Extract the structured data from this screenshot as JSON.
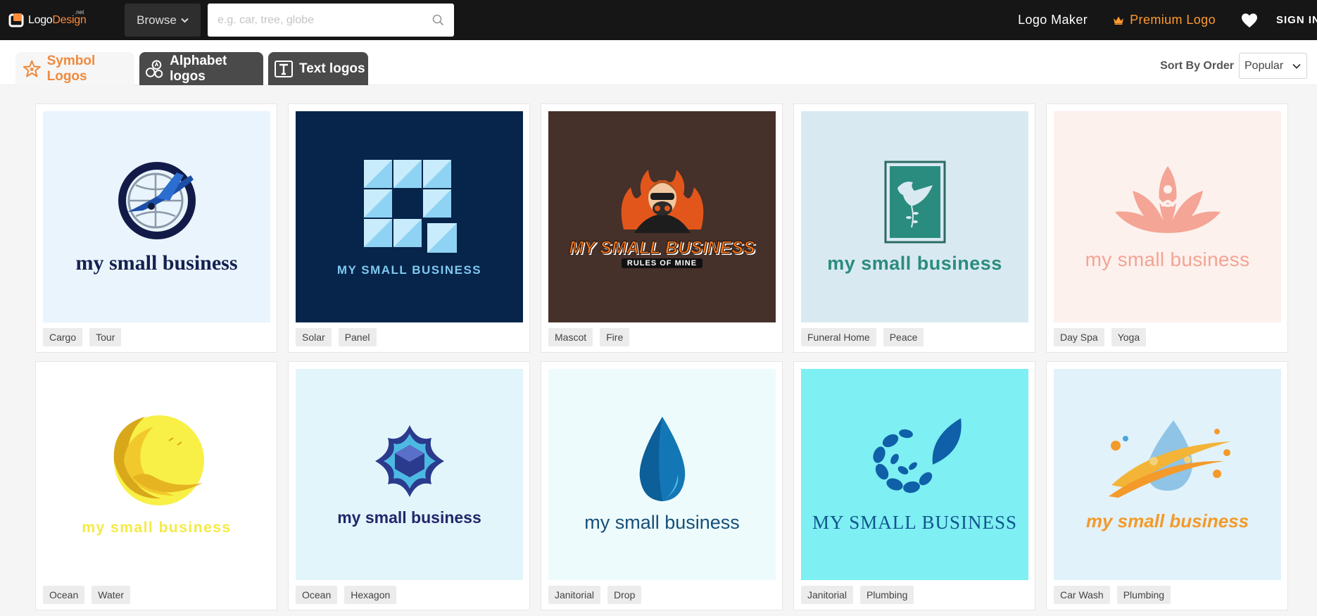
{
  "header": {
    "logo": {
      "name": "Logo",
      "accent": "Design",
      "suffix": ".net"
    },
    "browse_label": "Browse",
    "search_placeholder": "e.g. car, tree, globe",
    "logo_maker": "Logo Maker",
    "premium_logo": "Premium Logo",
    "sign_in": "SIGN IN"
  },
  "tabs": [
    {
      "label": "Symbol Logos",
      "active": true
    },
    {
      "label": "Alphabet logos",
      "active": false
    },
    {
      "label": "Text logos",
      "active": false
    }
  ],
  "sort": {
    "label": "Sort By Order",
    "value": "Popular"
  },
  "colors": {
    "topbar": "#161616",
    "accent": "#f08a3c",
    "premium": "#ff9a2e"
  },
  "cards": [
    {
      "art": "globe-plane-icon",
      "text": "my small business",
      "bg": "#eaf4fc",
      "color": "#142150",
      "tags": [
        "Cargo",
        "Tour"
      ]
    },
    {
      "art": "blue-squares-icon",
      "text": "MY SMALL BUSINESS",
      "bg": "#07244a",
      "color": "#7fc8ef",
      "tags": [
        "Solar",
        "Panel"
      ]
    },
    {
      "art": "mascot-fire-icon",
      "text": "MY SMALL BUSINESS",
      "subtext": "RULES OF MINE",
      "bg": "#45302a",
      "color": "#ff7a1a",
      "tags": [
        "Mascot",
        "Fire"
      ]
    },
    {
      "art": "dove-frame-icon",
      "text": "my small business",
      "bg": "#d9e9f2",
      "color": "#2a8c7e",
      "tags": [
        "Funeral Home",
        "Peace"
      ]
    },
    {
      "art": "lotus-yoga-icon",
      "text": "my small business",
      "bg": "#fdf1ee",
      "color": "#f3a493",
      "tags": [
        "Day Spa",
        "Yoga"
      ]
    },
    {
      "art": "sun-wave-icon",
      "text": "my small business",
      "bg": "#ffffff",
      "color": "#f4ea42",
      "tags": [
        "Ocean",
        "Water"
      ]
    },
    {
      "art": "star-hexagon-icon",
      "text": "my small business",
      "bg": "#e2f5fb",
      "color": "#23266b",
      "tags": [
        "Ocean",
        "Hexagon"
      ]
    },
    {
      "art": "water-drop-icon",
      "text": "my small business",
      "bg": "#eefbfc",
      "color": "#15507a",
      "tags": [
        "Janitorial",
        "Drop"
      ]
    },
    {
      "art": "spiral-leaves-icon",
      "text": "MY SMALL BUSINESS",
      "bg": "#7eeff2",
      "color": "#10558f",
      "tags": [
        "Janitorial",
        "Plumbing"
      ]
    },
    {
      "art": "drop-swoosh-icon",
      "text": "my small business",
      "bg": "#e2f2fa",
      "color": "#f39a2a",
      "tags": [
        "Car Wash",
        "Plumbing"
      ]
    }
  ]
}
